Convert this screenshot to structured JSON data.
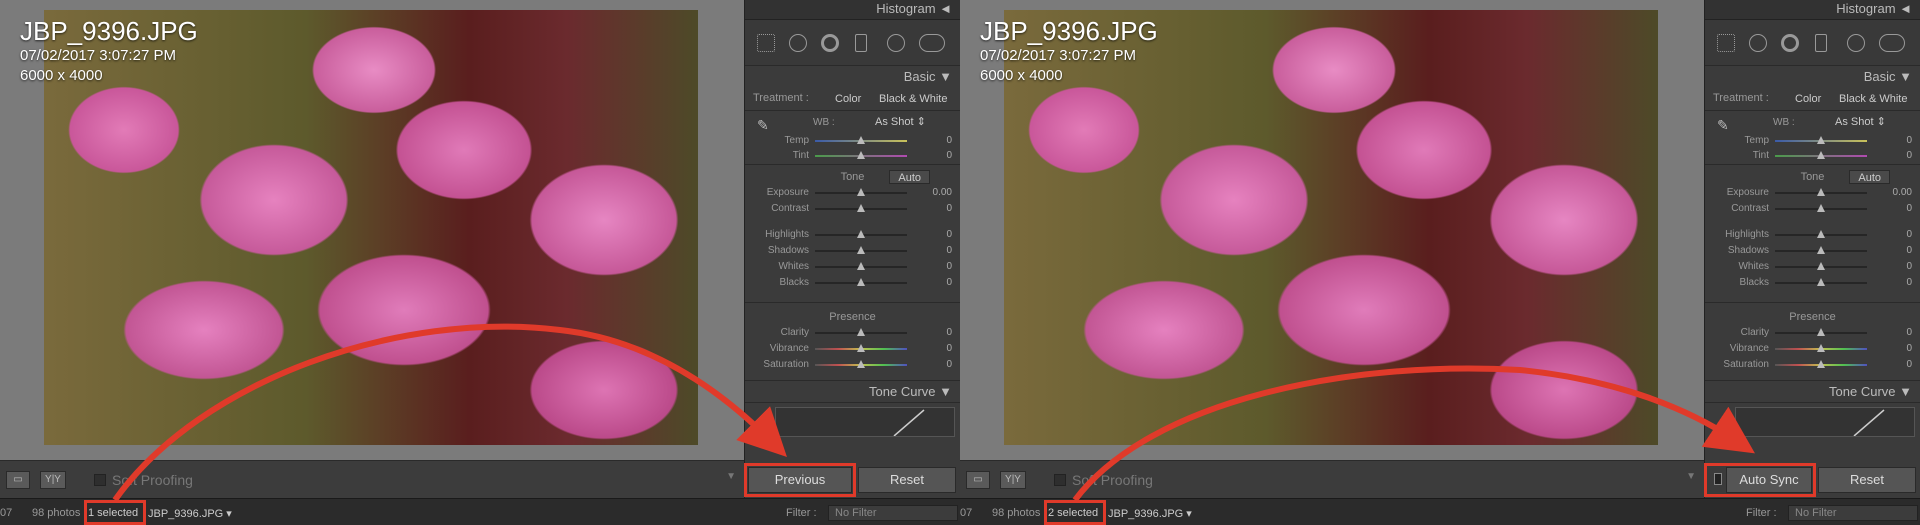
{
  "left": {
    "photo": {
      "filename": "JBP_9396.JPG",
      "datetime": "07/02/2017 3:07:27 PM",
      "dimensions": "6000 x 4000"
    },
    "toolbar": {
      "loupe_label": "",
      "compare_label": "Y|Y",
      "soft_proofing_label": "Soft Proofing"
    },
    "panel": {
      "histogram_label": "Histogram ◄",
      "basic_label": "Basic ▼",
      "treatment_label": "Treatment :",
      "color_label": "Color",
      "bw_label": "Black & White",
      "wb_label": "WB :",
      "wb_value": "As Shot ⇕",
      "tone_label": "Tone",
      "auto_label": "Auto",
      "presence_label": "Presence",
      "tone_curve_label": "Tone Curve ▼",
      "sliders": {
        "temp": {
          "label": "Temp",
          "value": "0"
        },
        "tint": {
          "label": "Tint",
          "value": "0"
        },
        "exposure": {
          "label": "Exposure",
          "value": "0.00"
        },
        "contrast": {
          "label": "Contrast",
          "value": "0"
        },
        "highlights": {
          "label": "Highlights",
          "value": "0"
        },
        "shadows": {
          "label": "Shadows",
          "value": "0"
        },
        "whites": {
          "label": "Whites",
          "value": "0"
        },
        "blacks": {
          "label": "Blacks",
          "value": "0"
        },
        "clarity": {
          "label": "Clarity",
          "value": "0"
        },
        "vibrance": {
          "label": "Vibrance",
          "value": "0"
        },
        "saturation": {
          "label": "Saturation",
          "value": "0"
        }
      }
    },
    "buttons": {
      "primary_label": "Previous",
      "reset_label": "Reset"
    },
    "status": {
      "index": "07",
      "photos": "98 photos",
      "selected": "1 selected",
      "current_file": "JBP_9396.JPG ▾",
      "filter_label": "Filter :",
      "filter_value": "No Filter"
    }
  },
  "right": {
    "photo": {
      "filename": "JBP_9396.JPG",
      "datetime": "07/02/2017 3:07:27 PM",
      "dimensions": "6000 x 4000"
    },
    "toolbar": {
      "loupe_label": "",
      "compare_label": "Y|Y",
      "soft_proofing_label": "Soft Proofing"
    },
    "panel": {
      "histogram_label": "Histogram ◄",
      "basic_label": "Basic ▼",
      "treatment_label": "Treatment :",
      "color_label": "Color",
      "bw_label": "Black & White",
      "wb_label": "WB :",
      "wb_value": "As Shot ⇕",
      "tone_label": "Tone",
      "auto_label": "Auto",
      "presence_label": "Presence",
      "tone_curve_label": "Tone Curve ▼",
      "sliders": {
        "temp": {
          "label": "Temp",
          "value": "0"
        },
        "tint": {
          "label": "Tint",
          "value": "0"
        },
        "exposure": {
          "label": "Exposure",
          "value": "0.00"
        },
        "contrast": {
          "label": "Contrast",
          "value": "0"
        },
        "highlights": {
          "label": "Highlights",
          "value": "0"
        },
        "shadows": {
          "label": "Shadows",
          "value": "0"
        },
        "whites": {
          "label": "Whites",
          "value": "0"
        },
        "blacks": {
          "label": "Blacks",
          "value": "0"
        },
        "clarity": {
          "label": "Clarity",
          "value": "0"
        },
        "vibrance": {
          "label": "Vibrance",
          "value": "0"
        },
        "saturation": {
          "label": "Saturation",
          "value": "0"
        }
      }
    },
    "buttons": {
      "primary_label": "Auto Sync",
      "reset_label": "Reset"
    },
    "status": {
      "index": "07",
      "photos": "98 photos",
      "selected": "2 selected",
      "current_file": "JBP_9396.JPG ▾",
      "filter_label": "Filter :",
      "filter_value": "No Filter"
    }
  },
  "colors": {
    "highlight": "#e03a2a",
    "panel_bg": "#3b3b3b"
  }
}
